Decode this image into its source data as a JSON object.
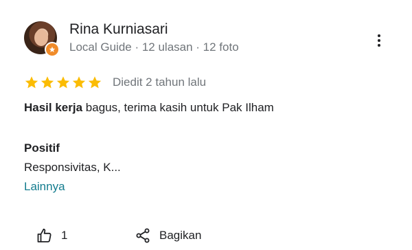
{
  "reviewer": {
    "name": "Rina Kurniasari",
    "meta": "Local Guide · 12 ulasan · 12 foto"
  },
  "rating": {
    "stars": 5,
    "edited": "Diedit 2 tahun lalu",
    "star_color": "#fbbc04"
  },
  "review": {
    "bold_part": "Hasil kerja",
    "rest": " bagus, terima kasih untuk Pak Ilham"
  },
  "positive": {
    "title": "Positif",
    "body": "Responsivitas, K...",
    "more_label": "Lainnya"
  },
  "actions": {
    "like_count": "1",
    "share_label": "Bagikan"
  },
  "icons": {
    "menu": "more-vert-icon",
    "like": "thumb-up-icon",
    "share": "share-icon",
    "badge": "local-guide-badge-icon"
  },
  "colors": {
    "link": "#137c8e",
    "secondary_text": "#70757a",
    "badge": "#f08b2a"
  }
}
